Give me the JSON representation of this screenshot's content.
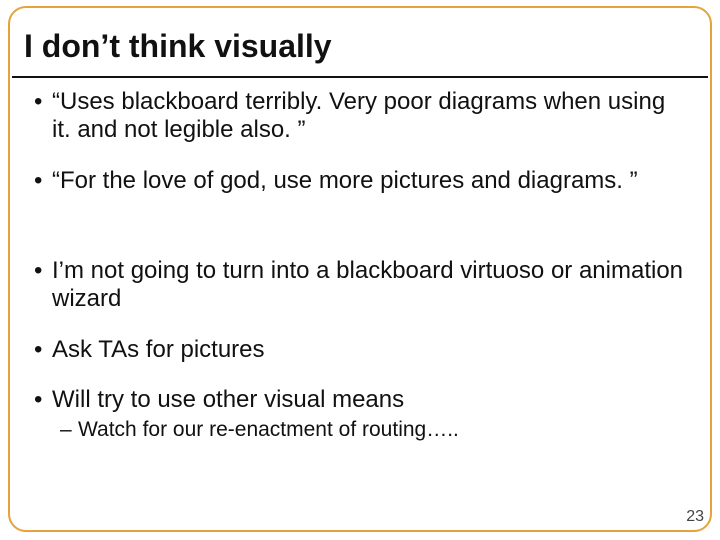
{
  "slide": {
    "title": "I don’t think visually",
    "bullets": [
      "“Uses blackboard terribly. Very poor diagrams when using it. and not legible also. ”",
      "“For the love of god, use more pictures and diagrams. ”",
      "I’m not going to turn into a blackboard virtuoso or animation wizard",
      "Ask TAs for pictures",
      "Will try to use other visual means"
    ],
    "subbullet": "Watch for our re-enactment of routing…..",
    "page_number": "23"
  }
}
